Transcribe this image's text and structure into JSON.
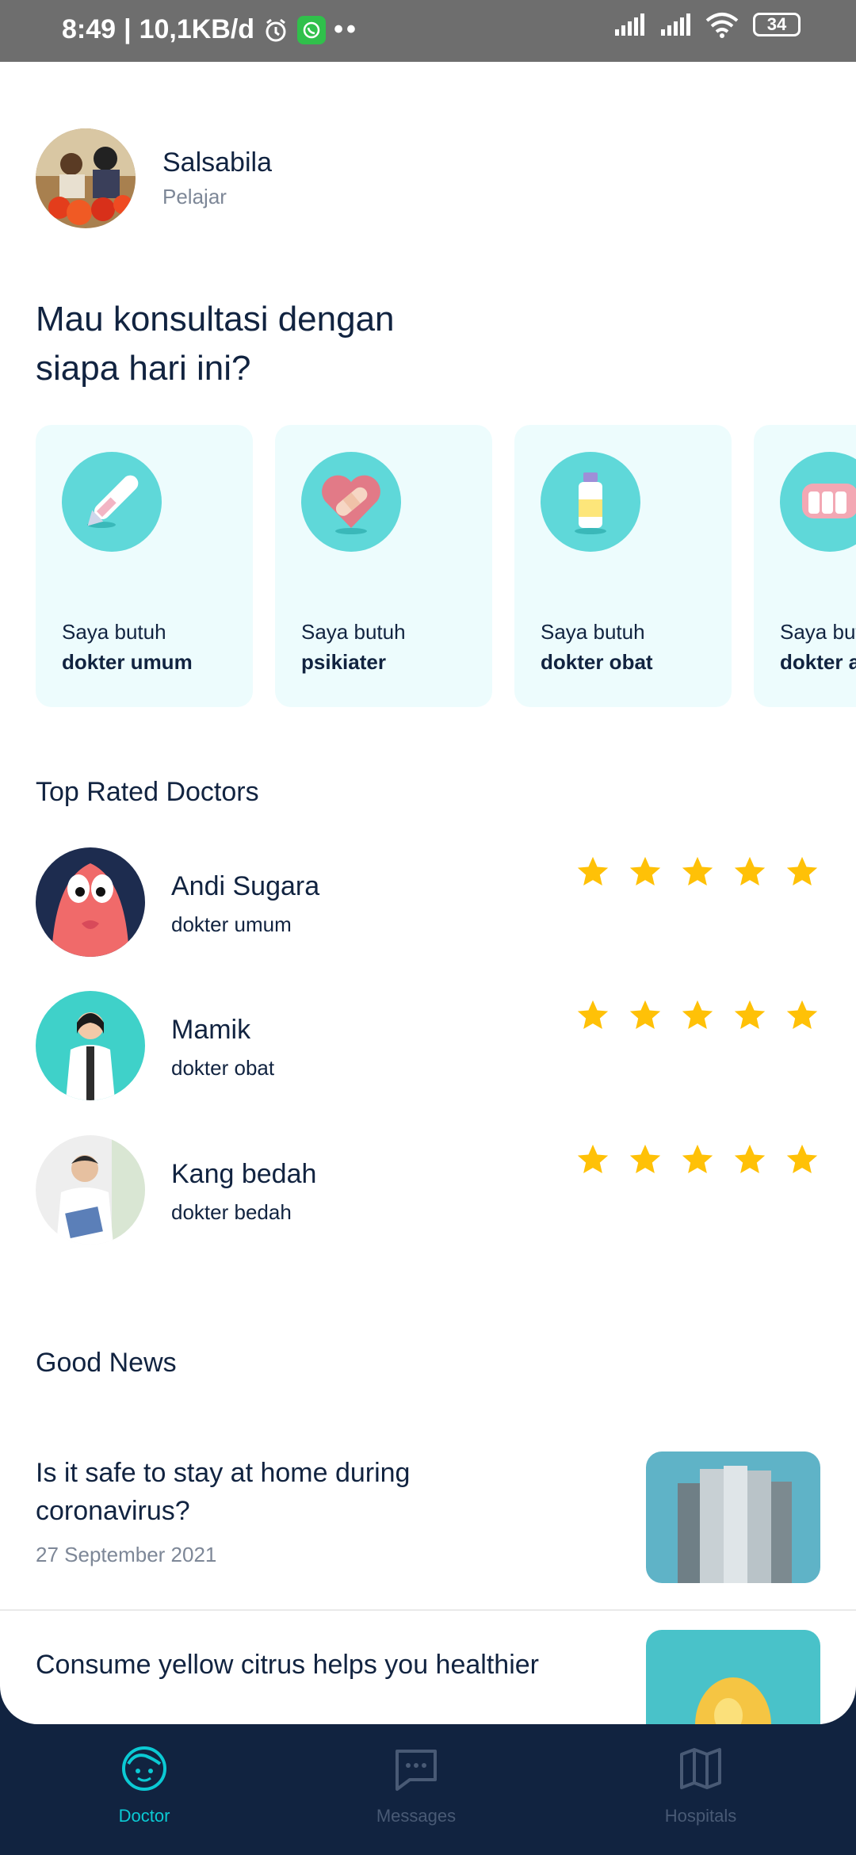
{
  "status_bar": {
    "time": "8:49",
    "speed": "10,1KB/d",
    "battery": "34"
  },
  "profile": {
    "name": "Salsabila",
    "role": "Pelajar"
  },
  "headline": "Mau konsultasi dengan siapa hari ini?",
  "categories": [
    {
      "line1": "Saya butuh",
      "line2": "dokter umum",
      "icon": "thermometer-icon"
    },
    {
      "line1": "Saya butuh",
      "line2": "psikiater",
      "icon": "heart-bandage-icon"
    },
    {
      "line1": "Saya butuh",
      "line2": "dokter obat",
      "icon": "medicine-bottle-icon"
    },
    {
      "line1": "Saya butuh",
      "line2": "dokter a",
      "icon": "teeth-icon"
    }
  ],
  "top_rated": {
    "title": "Top Rated Doctors",
    "doctors": [
      {
        "name": "Andi Sugara",
        "specialty": "dokter umum",
        "rating": 5
      },
      {
        "name": "Mamik",
        "specialty": "dokter obat",
        "rating": 5
      },
      {
        "name": "Kang bedah",
        "specialty": "dokter bedah",
        "rating": 5
      }
    ]
  },
  "news": {
    "title": "Good News",
    "items": [
      {
        "title": "Is it safe to stay at home during coronavirus?",
        "date": "27 September 2021"
      },
      {
        "title": "Consume yellow citrus  helps you healthier",
        "date": ""
      }
    ]
  },
  "nav": {
    "items": [
      {
        "label": "Doctor",
        "active": true
      },
      {
        "label": "Messages",
        "active": false
      },
      {
        "label": "Hospitals",
        "active": false
      }
    ],
    "active_color": "#0bcad4",
    "inactive_color": "#495a75"
  },
  "colors": {
    "primary_dark": "#112340",
    "card_bg": "#edfcfd",
    "icon_bg": "#5fd8d9",
    "star": "#ffc107"
  }
}
